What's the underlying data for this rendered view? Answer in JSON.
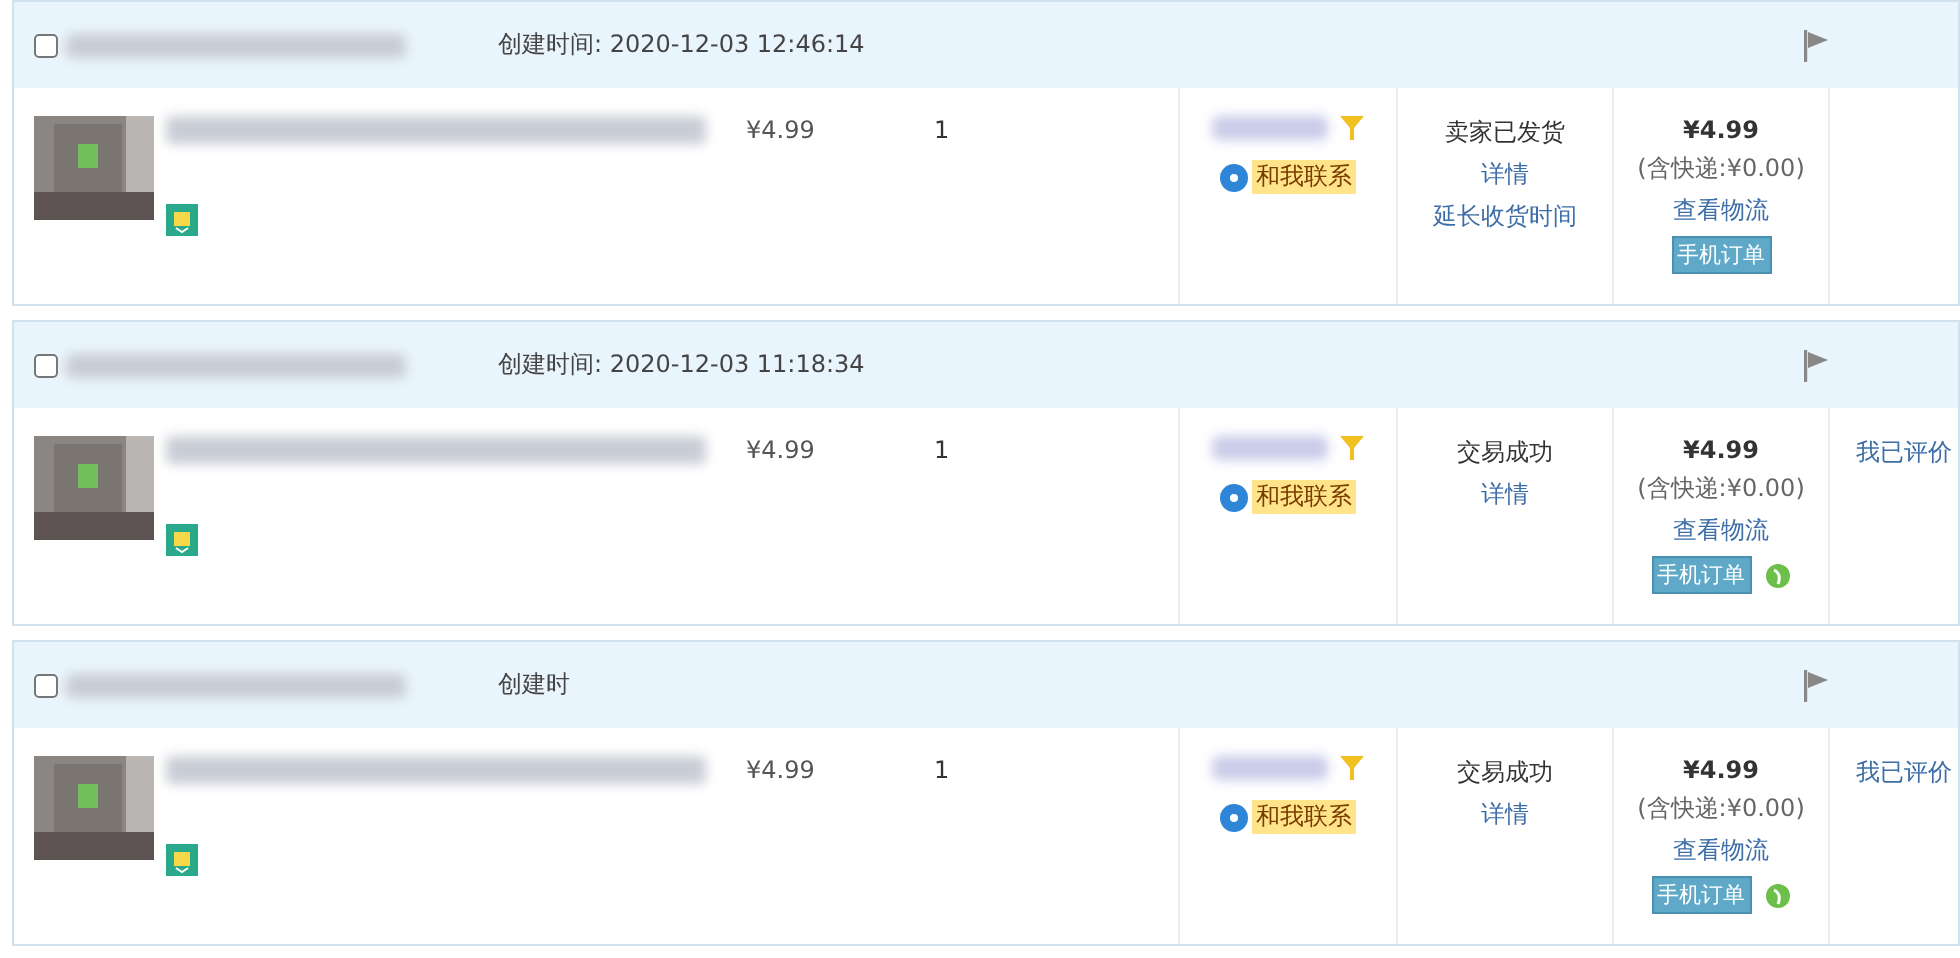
{
  "orders": [
    {
      "checked": false,
      "created": "创建时间: 2020-12-03 12:46:14",
      "price": "¥4.99",
      "quantity": "1",
      "contact": "和我联系",
      "status": "卖家已发货",
      "status_links": [
        "详情",
        "延长收货时间"
      ],
      "total": "¥4.99",
      "shipping": "(含快递:¥0.00)",
      "logistics": "查看物流",
      "mobile_tag": "手机订单",
      "eco_badge": false
    },
    {
      "checked": false,
      "created": "创建时间: 2020-12-03 11:18:34",
      "price": "¥4.99",
      "quantity": "1",
      "contact": "和我联系",
      "status": "交易成功",
      "status_links": [
        "详情"
      ],
      "total": "¥4.99",
      "shipping": "(含快递:¥0.00)",
      "logistics": "查看物流",
      "mobile_tag": "手机订单",
      "eco_badge": true,
      "review": "我已评价"
    },
    {
      "checked": false,
      "created": "创建时",
      "price": "¥4.99",
      "quantity": "1",
      "contact": "和我联系",
      "status": "交易成功",
      "status_links": [
        "详情"
      ],
      "total": "¥4.99",
      "shipping": "(含快递:¥0.00)",
      "logistics": "查看物流",
      "mobile_tag": "手机订单",
      "eco_badge": true,
      "review": "我已评价"
    }
  ]
}
